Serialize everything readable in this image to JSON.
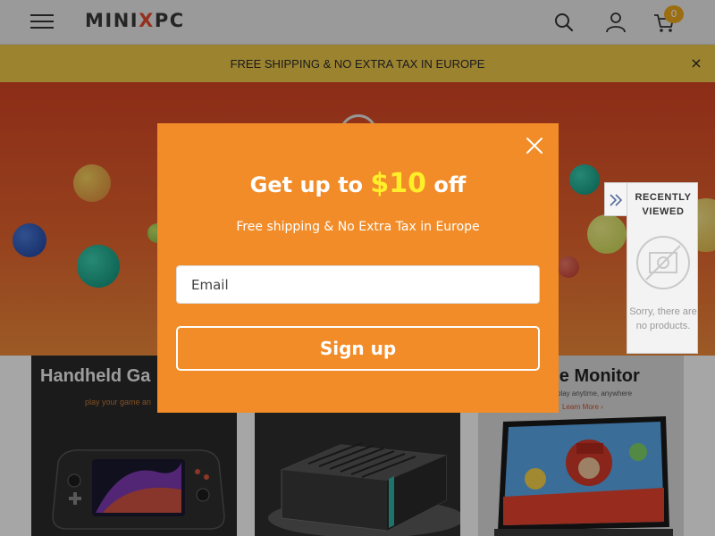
{
  "header": {
    "logo": {
      "part1": "MINI",
      "part2": "X",
      "part3": "PC"
    },
    "cart_count": "0",
    "icons": [
      "menu-icon",
      "search-icon",
      "user-icon",
      "cart-icon"
    ]
  },
  "announcement": {
    "text": "FREE SHIPPING & NO EXTRA TAX IN EUROPE",
    "close_symbol": "×"
  },
  "tiles": [
    {
      "title": "Handheld Ga",
      "subtitle": "play your game an"
    },
    {
      "title": ""
    },
    {
      "title": "ple Monitor",
      "subtitle": "play anytime, anywhere",
      "link": "Learn More ›"
    }
  ],
  "recently_viewed": {
    "title": "RECENTLY VIEWED",
    "empty_text": "Sorry, there are no products."
  },
  "popup": {
    "headline_lead": "Get up to ",
    "headline_amount": "$10",
    "headline_tail": " off",
    "subtitle": "Free shipping & No Extra Tax in Europe",
    "email_placeholder": "Email",
    "email_value": "",
    "button_label": "Sign up"
  },
  "colors": {
    "popup_bg": "#f28c28",
    "amount": "#ffee2a",
    "announcement_bg": "#eec94b",
    "badge": "#f0a91d"
  }
}
